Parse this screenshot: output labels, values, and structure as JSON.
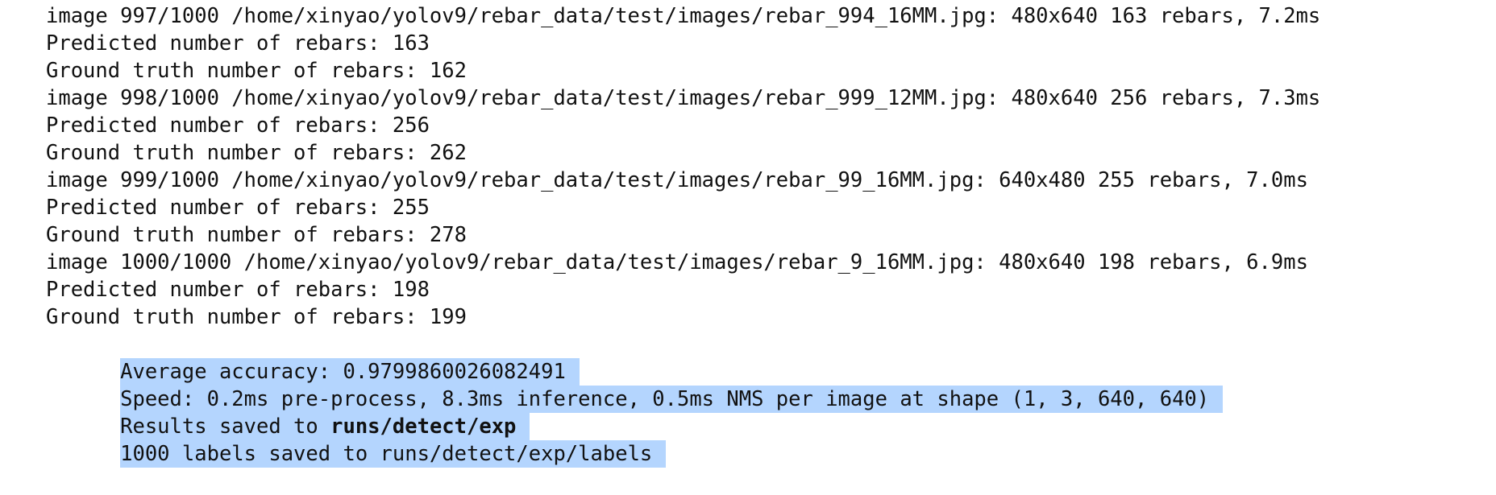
{
  "terminal": {
    "lines": [
      "image 997/1000 /home/xinyao/yolov9/rebar_data/test/images/rebar_994_16MM.jpg: 480x640 163 rebars, 7.2ms",
      "Predicted number of rebars: 163",
      "Ground truth number of rebars: 162",
      "image 998/1000 /home/xinyao/yolov9/rebar_data/test/images/rebar_999_12MM.jpg: 480x640 256 rebars, 7.3ms",
      "Predicted number of rebars: 256",
      "Ground truth number of rebars: 262",
      "image 999/1000 /home/xinyao/yolov9/rebar_data/test/images/rebar_99_16MM.jpg: 640x480 255 rebars, 7.0ms",
      "Predicted number of rebars: 255",
      "Ground truth number of rebars: 278",
      "image 1000/1000 /home/xinyao/yolov9/rebar_data/test/images/rebar_9_16MM.jpg: 480x640 198 rebars, 6.9ms",
      "Predicted number of rebars: 198",
      "Ground truth number of rebars: 199"
    ],
    "selected": {
      "accuracy": "Average accuracy: 0.9799860026082491",
      "speed": "Speed: 0.2ms pre-process, 8.3ms inference, 0.5ms NMS per image at shape (1, 3, 640, 640)",
      "results_prefix": "Results saved to ",
      "results_path": "runs/detect/exp",
      "labels": "1000 labels saved to runs/detect/exp/labels"
    },
    "selection_color": "#b4d5fe",
    "text_color": "#111111",
    "background_color": "#ffffff"
  }
}
